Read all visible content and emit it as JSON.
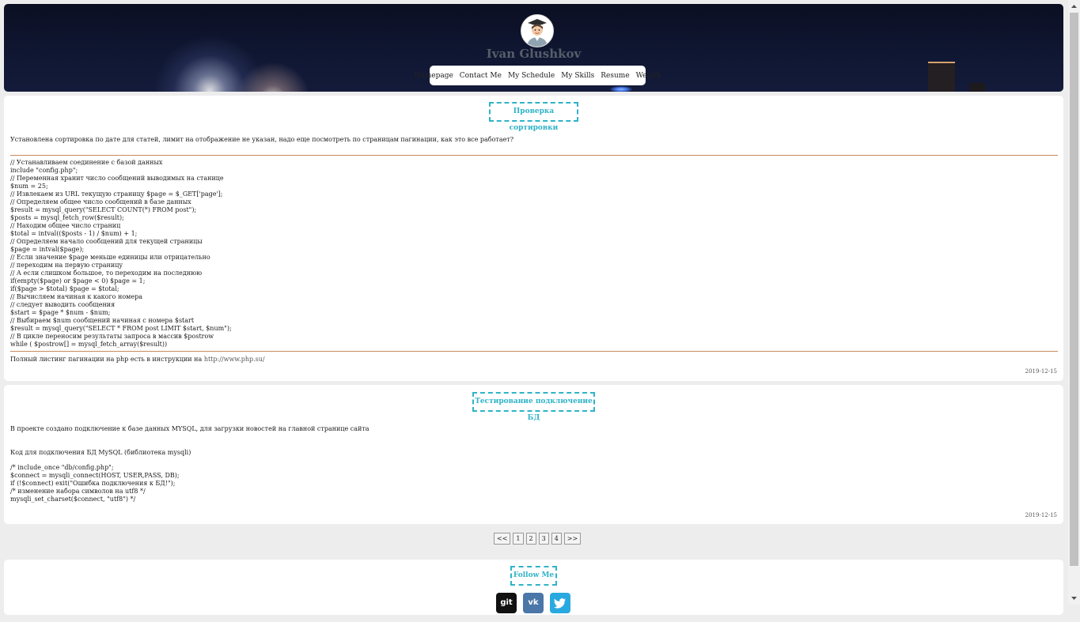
{
  "header": {
    "site_name": "Ivan Glushkov",
    "nav": [
      "Homepage",
      "Contact Me",
      "My Schedule",
      "My Skills",
      "Resume",
      "Weigth"
    ]
  },
  "articles": [
    {
      "title": "Проверка сортировки",
      "intro": "Установлена сортировка по дате для статей, лимит на отображение не указан, надо еще посмотреть по страницам пагинации, как это все работает?",
      "code": [
        "// Устанавливаем соединение с базой данных",
        "include \"config.php\";",
        "// Переменная хранит число сообщений выводимых на станице",
        "$num = 25;",
        "// Извлекаем из URL текущую страницу $page = $_GET['page'];",
        "// Определяем общее число сообщений в базе данных",
        "$result = mysql_query(\"SELECT COUNT(*) FROM post\");",
        "$posts = mysql_fetch_row($result);",
        "// Находим общее число страниц",
        "$total = intval(($posts - 1) / $num) + 1;",
        "// Определяем начало сообщений для текущей страницы",
        "$page = intval($page);",
        "// Если значение $page меньше единицы или отрицательно",
        "// переходим на первую страницу",
        "// А если слишком большое, то переходим на последнюю",
        "if(empty($page) or $page < 0) $page = 1;",
        "if($page > $total) $page = $total;",
        "// Вычисляем начиная к какого номера",
        "// следует выводить сообщения",
        "$start = $page * $num - $num;",
        "// Выбираем $num сообщений начиная с номера $start",
        "$result = mysql_query(\"SELECT * FROM post LIMIT $start, $num\");",
        "// В цикле переносим результаты запроса в массив $postrow",
        "while ( $postrow[] = mysql_fetch_array($result))"
      ],
      "outro_text": "Полный листинг пагинации на php есть в инструкции на",
      "outro_link": "http://www.php.su/",
      "date": "2019-12-15"
    },
    {
      "title": "Тестирование подключение БД",
      "intro": "В проекте создано подключение к базе данных MYSQL, для загрузки новостей на главной странице сайта",
      "subtitle": "Код для подключения БД MySQL (библиотека mysqli)",
      "code": [
        "/* include_once \"db/config.php\";",
        "$connect = mysqli_connect(HOST, USER,PASS, DB);",
        "if (!$connect) exit(\"Ошибка подключения к БД!\");",
        "/* изменение набора символов на utf8 */",
        "mysqli_set_charset($connect, \"utf8\") */"
      ],
      "date": "2019-12-15"
    }
  ],
  "pagination": [
    "<<",
    "1",
    "2",
    "3",
    "4",
    ">>"
  ],
  "footer": {
    "title": "Follow Me",
    "social": [
      {
        "label": "git",
        "icon": "git-icon",
        "color": "#111111"
      },
      {
        "label": "vk",
        "icon": "vk-icon",
        "color": "#4a76a8"
      },
      {
        "label": "",
        "icon": "twitter-icon",
        "color": "#2aa9e0"
      }
    ]
  }
}
